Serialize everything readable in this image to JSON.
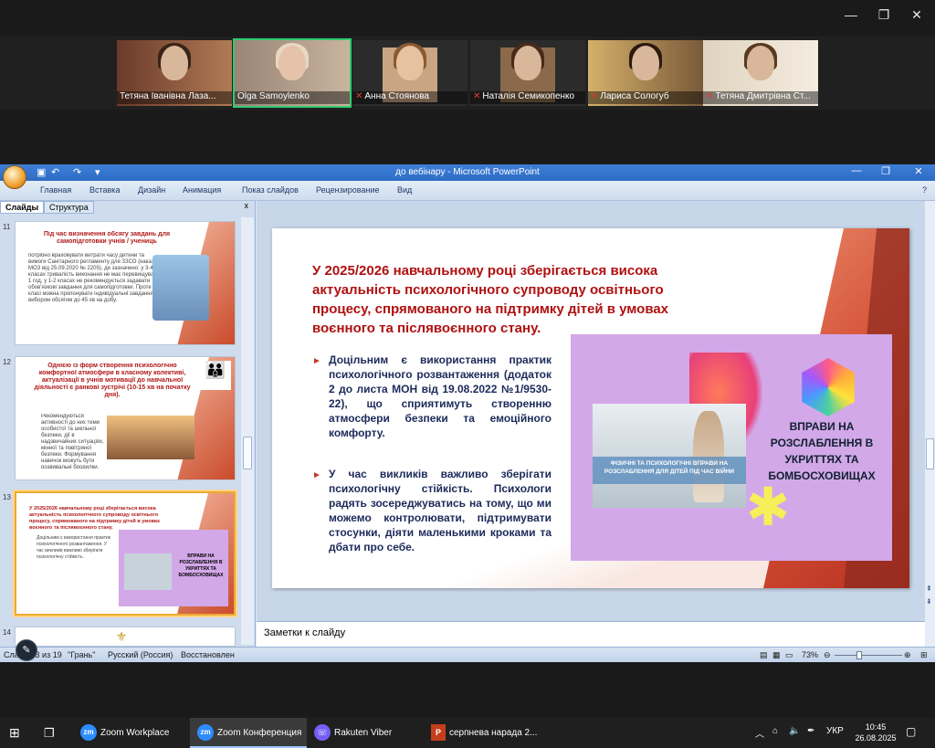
{
  "zoom": {
    "participants": [
      {
        "name": "Тетяна Іванівна Лаза...",
        "muted": false,
        "active": false
      },
      {
        "name": "Olga Samoylenko",
        "muted": false,
        "active": true
      },
      {
        "name": "Анна Стоянова",
        "muted": true,
        "active": false
      },
      {
        "name": "Наталія Семикопенко",
        "muted": true,
        "active": false
      },
      {
        "name": "Лариса Сологуб",
        "muted": true,
        "active": false
      },
      {
        "name": "Тетяна Дмитрівна Ст...",
        "muted": true,
        "active": false
      }
    ],
    "window_controls": {
      "minimize": "—",
      "restore": "❐",
      "close": "✕"
    }
  },
  "ppt": {
    "title": "до вебінару - Microsoft PowerPoint",
    "tabs": [
      "Главная",
      "Вставка",
      "Дизайн",
      "Анимация",
      "Показ слайдов",
      "Рецензирование",
      "Вид"
    ],
    "pane_tabs": {
      "slides": "Слайды",
      "outline": "Структура",
      "close": "x"
    },
    "thumbs": [
      {
        "num": "11",
        "heading": "Під час визначення обсягу завдань для самопідготовки учнів / учениць",
        "body": "потрібно враховувати витрати часу дитини та вимоги Санітарного регламенту для ЗЗСО (наказ МОЗ від 25.09.2020 № 2205), де зазначено: у 3-4 класах тривалість виконання не має перевищувати 1 год, у 1-2 класах не рекомендується задавати обов'язкові завдання для самопідготовки. Проте у 2 класі можна пропонувати індивідуальні завдання за вибором обсягом до 45 хв на добу."
      },
      {
        "num": "12",
        "heading": "Однією із форм створення психологічно комфортної атмосфери в класному колективі, актуалізації в учнів мотивації до навчальної діяльності є ранкові зустрічі (10-15 хв на початку дня).",
        "body": "Рекомендуються активності до них теми особистої та шкільної безпеки, дії в надзвичайних ситуаціях, мінної та повітряної безпеки. Формування навичок можуть бути розвивальні бродилки."
      },
      {
        "num": "13",
        "heading": "У 2025/2026 навчальному році зберігається висока актуальність психологічного супроводу освітнього процесу, спрямованого на підтримку дітей в умовах воєнного та післявоєнного стану.",
        "body": "Доцільним є використання практик психологічного розвантаження. У час викликів важливо зберігати психологічну стійкість."
      },
      {
        "num": "14",
        "heading": "",
        "body": ""
      }
    ],
    "slide": {
      "title": "У 2025/2026 навчальному році зберігається висока актуальність психологічного супроводу освітнього процесу, спрямованого на підтримку дітей в умовах воєнного та післявоєнного стану.",
      "bullet1": "Доцільним є використання практик психологічного розвантаження (додаток 2 до листа МОН від 19.08.2022 №1/9530-22), що сприятимуть створенню атмосфери безпеки та емоційного комфорту.",
      "bullet2": "У час викликів важливо зберігати психологічну стійкість. Психологи радять зосереджуватись на тому, що ми можемо контролювати, підтримувати стосунки, діяти маленькими кроками та дбати про себе.",
      "bullet_glyph": "►",
      "image_caption": "ФІЗИЧНІ ТА ПСИХОЛОГІЧНІ ВПРАВИ НА РОЗСЛАБЛЕННЯ ДЛЯ ДІТЕЙ ПІД ЧАС ВІЙНИ",
      "image_title": "ВПРАВИ НА РОЗСЛАБЛЕННЯ В УКРИТТЯХ ТА БОМБОСХОВИЩАХ"
    },
    "notes_placeholder": "Заметки к слайду",
    "status": {
      "slide_counter": "Слайд 13 из 19",
      "theme": "\"Грань\"",
      "language": "Русский (Россия)",
      "state": "Восстановлен",
      "zoom": "73%"
    }
  },
  "taskbar": {
    "apps": [
      {
        "label": "Zoom Workplace",
        "icon": "zm"
      },
      {
        "label": "Zoom Конференция",
        "icon": "zm"
      },
      {
        "label": "Rakuten Viber",
        "icon": "viber"
      },
      {
        "label": "серпнева нарада 2...",
        "icon": "P"
      }
    ],
    "lang": "УКР",
    "time": "10:45",
    "date": "26.08.2025"
  },
  "colors": {
    "accent": "#2d6cc4",
    "slide_title": "#b01010",
    "image_bg": "#d2a8e8"
  }
}
